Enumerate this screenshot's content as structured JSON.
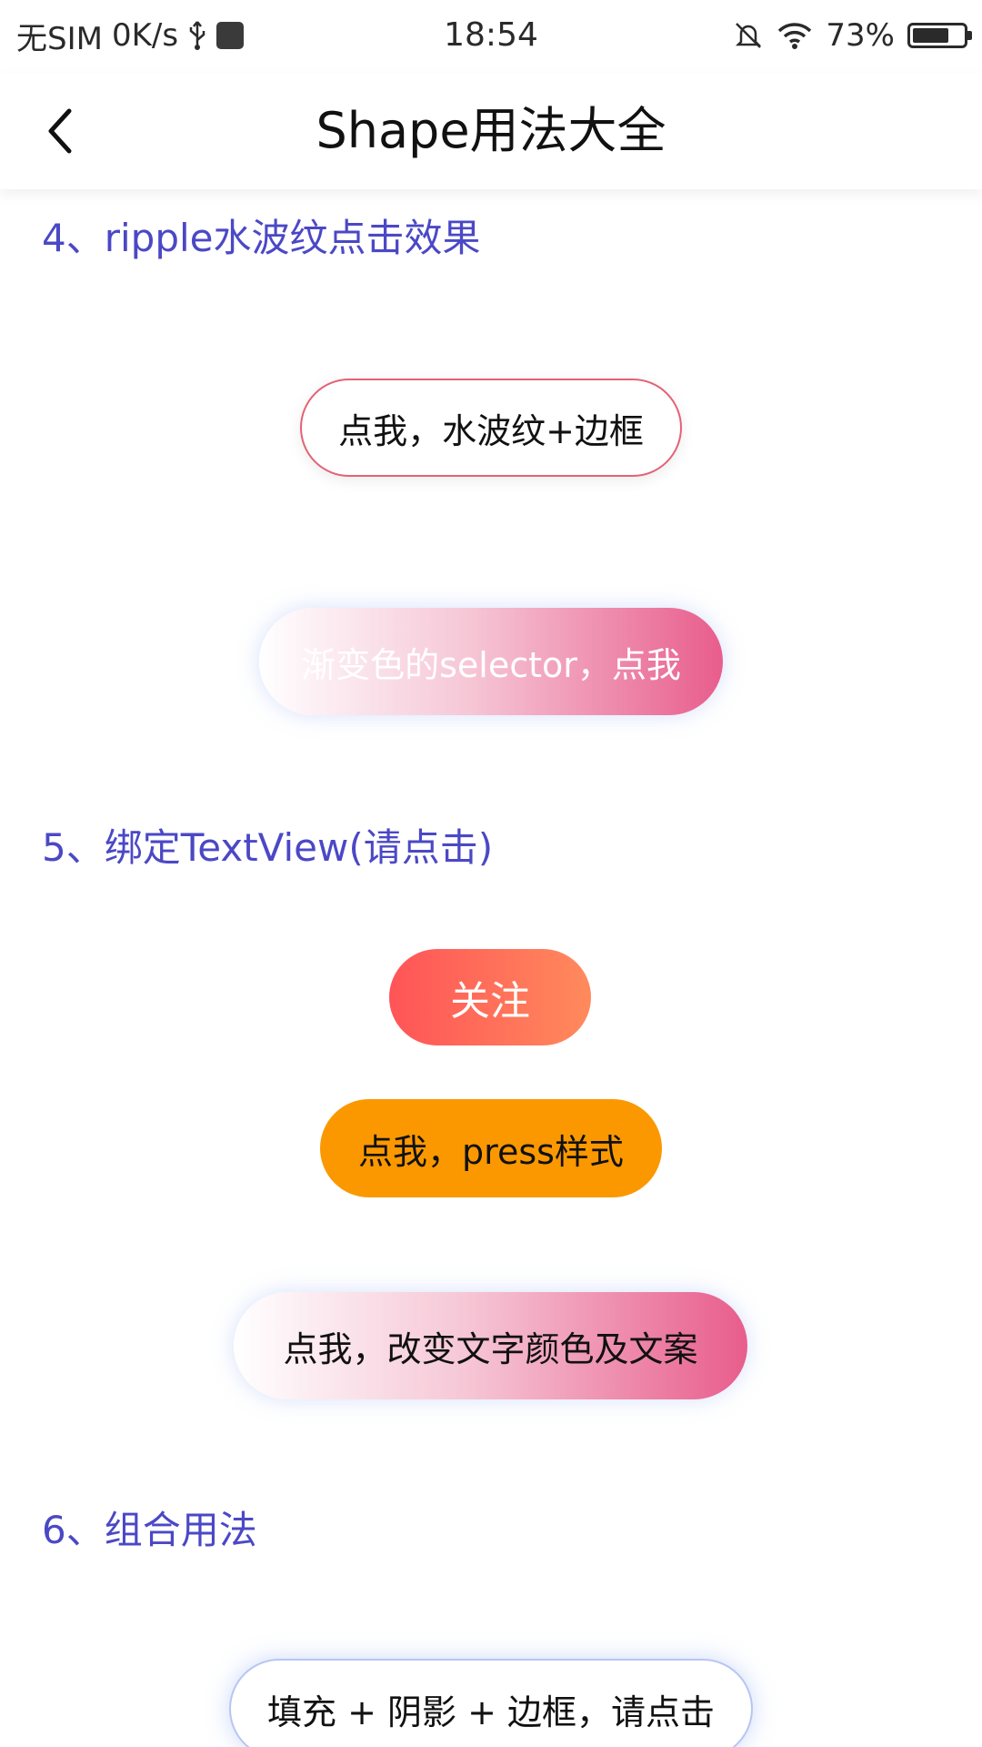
{
  "status_bar": {
    "carrier": "无SIM",
    "net_speed": "0K/s",
    "time": "18:54",
    "battery": "73%",
    "battery_level": 0.73,
    "icons": [
      "usb-icon",
      "usb-debug-icon",
      "mute-icon",
      "wifi-icon",
      "battery-icon"
    ]
  },
  "header": {
    "title": "Shape用法大全",
    "back_icon": "back-arrow-icon"
  },
  "sections": [
    {
      "title": "4、ripple水波纹点击效果",
      "buttons": [
        "点我，水波纹+边框",
        "渐变色的selector，点我"
      ]
    },
    {
      "title": "5、绑定TextView(请点击)",
      "buttons": [
        "关注",
        "点我，press样式",
        "点我，改变文字颜色及文案"
      ]
    },
    {
      "title": "6、组合用法",
      "buttons": [
        "填充 + 阴影 + 边框，请点击"
      ]
    }
  ],
  "colors": {
    "section_title": "#4b48c6",
    "ripple_border": "#e36276",
    "gradient_pink_end": "#e85d8c",
    "follow_start": "#ff5457",
    "follow_end": "#ff8a5c",
    "press_bg": "#fb9800"
  }
}
